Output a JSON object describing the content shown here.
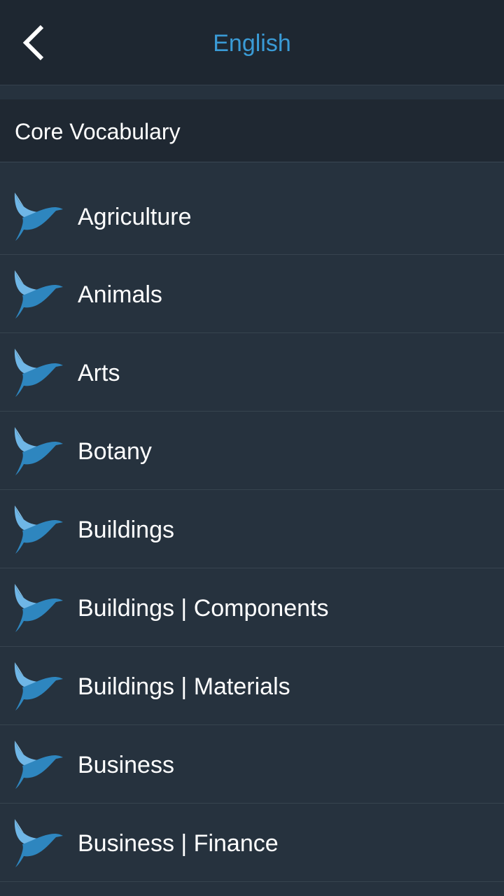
{
  "header": {
    "title": "English",
    "back_icon": "chevron-left-icon"
  },
  "section": {
    "title": "Core Vocabulary"
  },
  "categories": [
    {
      "label": "Agriculture",
      "icon": "bird-logo-icon"
    },
    {
      "label": "Animals",
      "icon": "bird-logo-icon"
    },
    {
      "label": "Arts",
      "icon": "bird-logo-icon"
    },
    {
      "label": "Botany",
      "icon": "bird-logo-icon"
    },
    {
      "label": "Buildings",
      "icon": "bird-logo-icon"
    },
    {
      "label": "Buildings | Components",
      "icon": "bird-logo-icon"
    },
    {
      "label": "Buildings | Materials",
      "icon": "bird-logo-icon"
    },
    {
      "label": "Business",
      "icon": "bird-logo-icon"
    },
    {
      "label": "Business | Finance",
      "icon": "bird-logo-icon"
    }
  ],
  "colors": {
    "accent": "#3a9bd6",
    "icon_light": "#6fb6e6",
    "icon_dark": "#2e86bf",
    "background": "#26323e",
    "header_background": "#1e2731"
  }
}
